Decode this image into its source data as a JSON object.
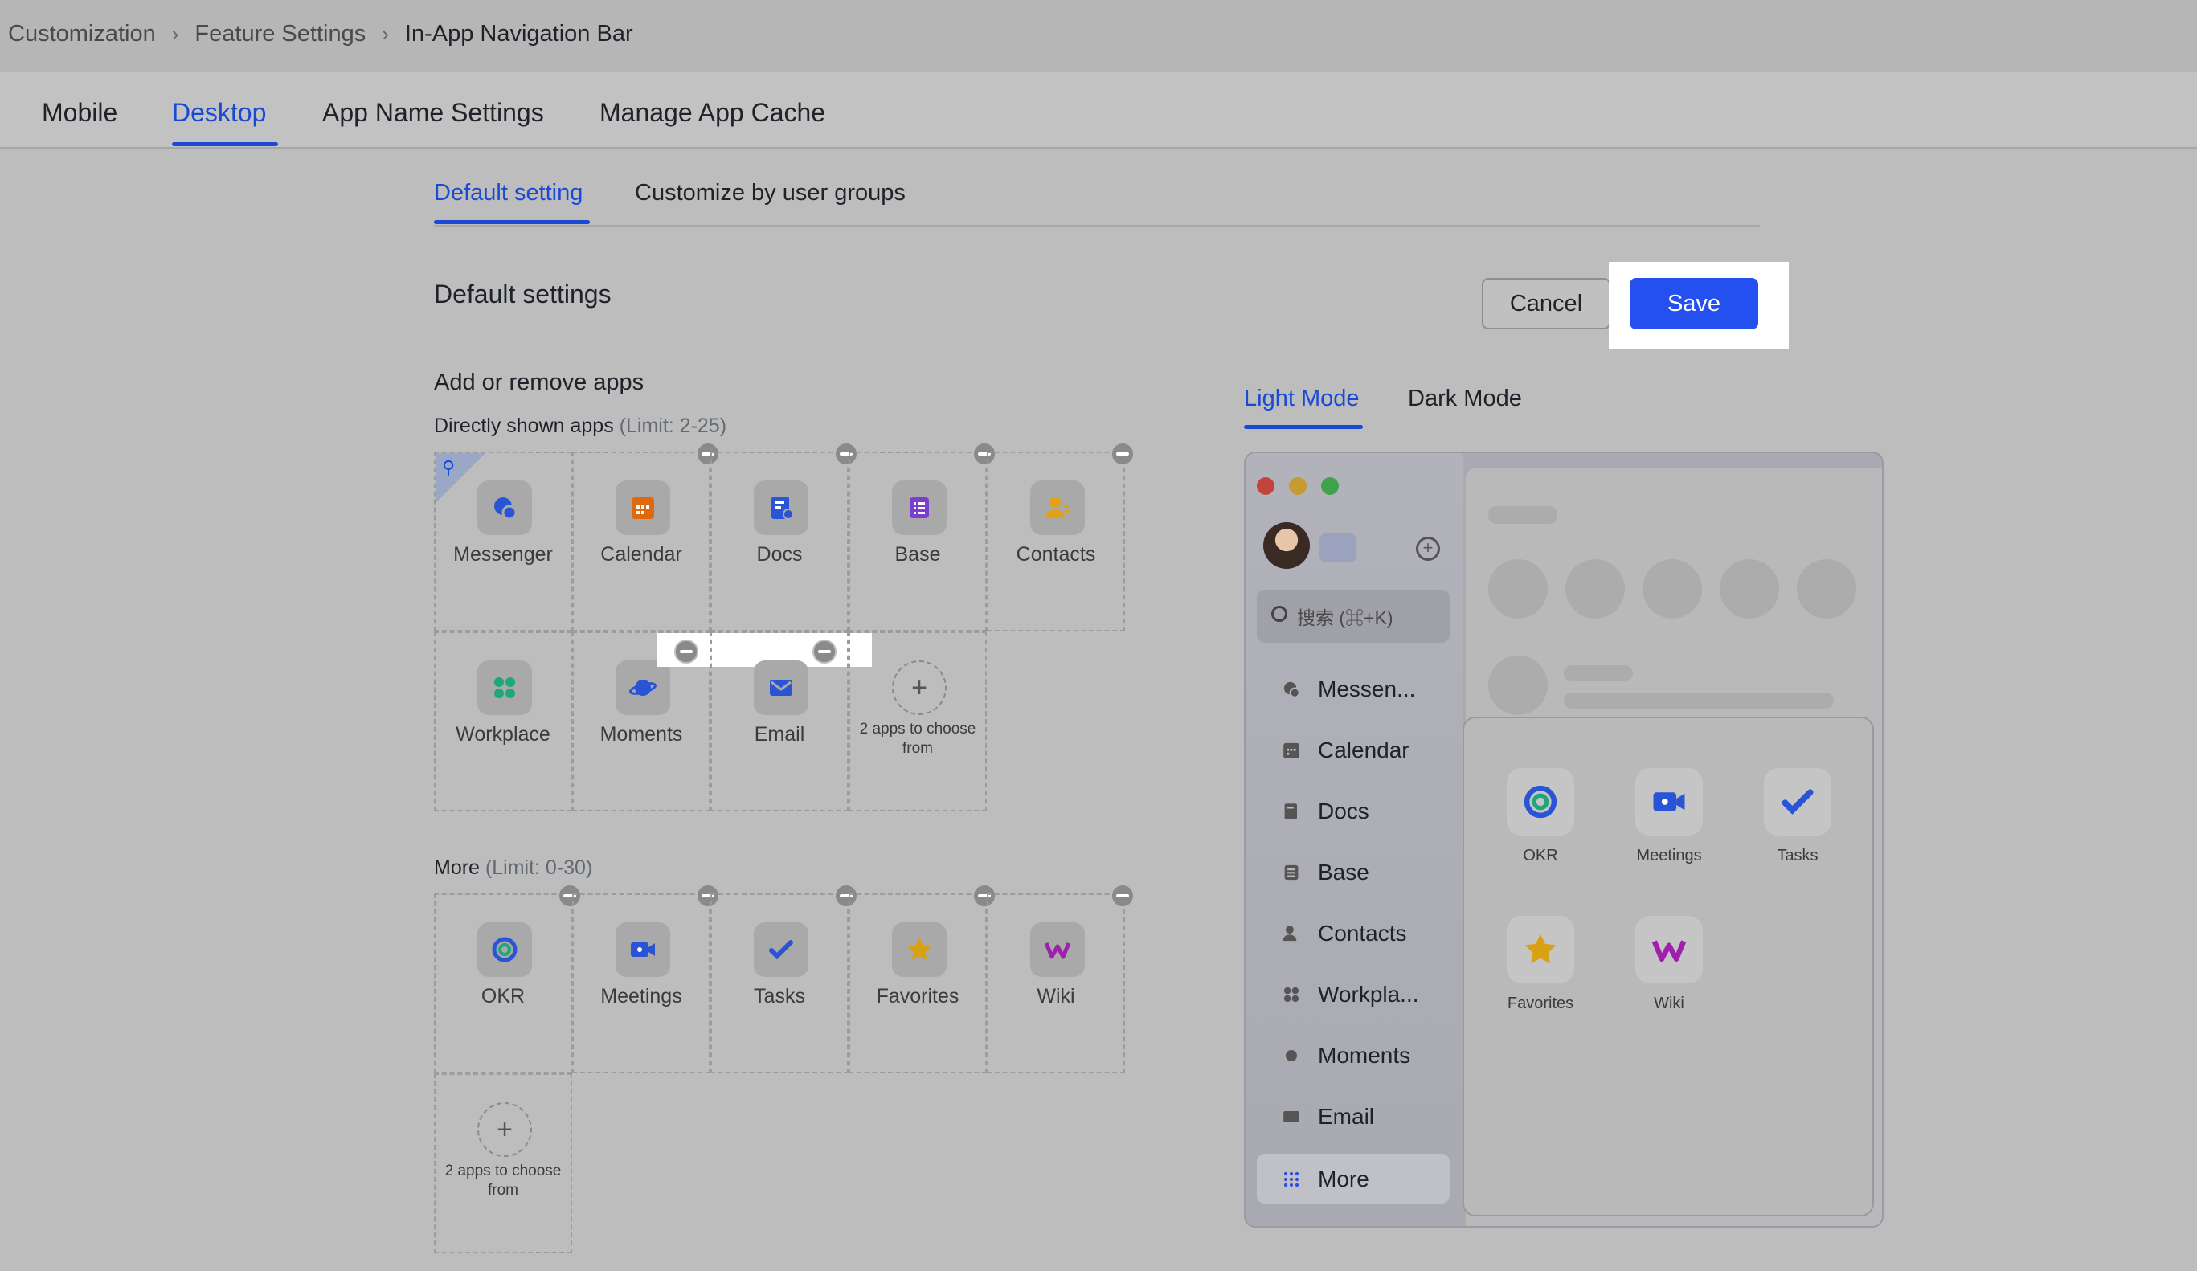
{
  "breadcrumb": {
    "items": [
      "Customization",
      "Feature Settings",
      "In-App Navigation Bar"
    ]
  },
  "tabs": [
    {
      "label": "Mobile"
    },
    {
      "label": "Desktop",
      "active": true
    },
    {
      "label": "App Name Settings"
    },
    {
      "label": "Manage App Cache"
    }
  ],
  "subtabs": [
    {
      "label": "Default setting",
      "active": true
    },
    {
      "label": "Customize by user groups"
    }
  ],
  "settings": {
    "title": "Default settings",
    "cancel_label": "Cancel",
    "save_label": "Save",
    "section_title": "Add or remove apps"
  },
  "direct": {
    "label": "Directly shown apps",
    "limit": "(Limit: 2-25)",
    "apps": [
      {
        "name": "Messenger",
        "icon": "messenger-icon"
      },
      {
        "name": "Calendar",
        "icon": "calendar-icon"
      },
      {
        "name": "Docs",
        "icon": "docs-icon"
      },
      {
        "name": "Base",
        "icon": "base-icon"
      },
      {
        "name": "Contacts",
        "icon": "contacts-icon"
      },
      {
        "name": "Workplace",
        "icon": "workplace-icon"
      },
      {
        "name": "Moments",
        "icon": "moments-icon"
      },
      {
        "name": "Email",
        "icon": "email-icon"
      }
    ],
    "add_text": "2 apps to choose from"
  },
  "more": {
    "label": "More",
    "limit": "(Limit: 0-30)",
    "apps": [
      {
        "name": "OKR",
        "icon": "okr-icon"
      },
      {
        "name": "Meetings",
        "icon": "meetings-icon"
      },
      {
        "name": "Tasks",
        "icon": "tasks-icon"
      },
      {
        "name": "Favorites",
        "icon": "favorites-icon"
      },
      {
        "name": "Wiki",
        "icon": "wiki-icon"
      }
    ],
    "add_text": "2 apps to choose from"
  },
  "modes": [
    {
      "label": "Light Mode",
      "active": true
    },
    {
      "label": "Dark Mode"
    }
  ],
  "preview": {
    "search_placeholder": "搜索 (⌘+K)",
    "nav": [
      "Messen...",
      "Calendar",
      "Docs",
      "Base",
      "Contacts",
      "Workpla...",
      "Moments",
      "Email",
      "More"
    ],
    "more_apps": [
      "OKR",
      "Meetings",
      "Tasks",
      "Favorites",
      "Wiki"
    ]
  },
  "colors": {
    "accent": "#1a49d4",
    "save": "#2450f0"
  }
}
